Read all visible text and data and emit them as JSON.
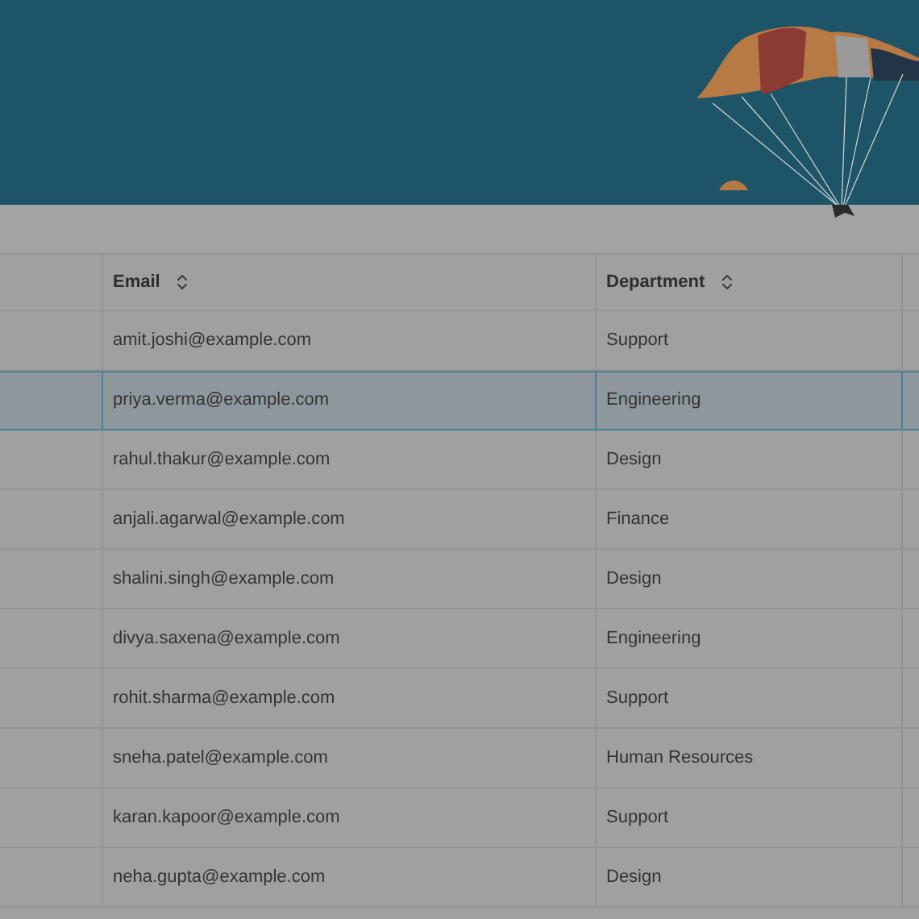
{
  "table": {
    "columns": [
      {
        "label": "Email"
      },
      {
        "label": "Department"
      }
    ],
    "rows": [
      {
        "email": "amit.joshi@example.com",
        "department": "Support",
        "selected": false
      },
      {
        "email": "priya.verma@example.com",
        "department": "Engineering",
        "selected": true
      },
      {
        "email": "rahul.thakur@example.com",
        "department": "Design",
        "selected": false
      },
      {
        "email": "anjali.agarwal@example.com",
        "department": "Finance",
        "selected": false
      },
      {
        "email": "shalini.singh@example.com",
        "department": "Design",
        "selected": false
      },
      {
        "email": "divya.saxena@example.com",
        "department": "Engineering",
        "selected": false
      },
      {
        "email": "rohit.sharma@example.com",
        "department": "Support",
        "selected": false
      },
      {
        "email": "sneha.patel@example.com",
        "department": "Human Resources",
        "selected": false
      },
      {
        "email": "karan.kapoor@example.com",
        "department": "Support",
        "selected": false
      },
      {
        "email": "neha.gupta@example.com",
        "department": "Design",
        "selected": false
      }
    ]
  }
}
